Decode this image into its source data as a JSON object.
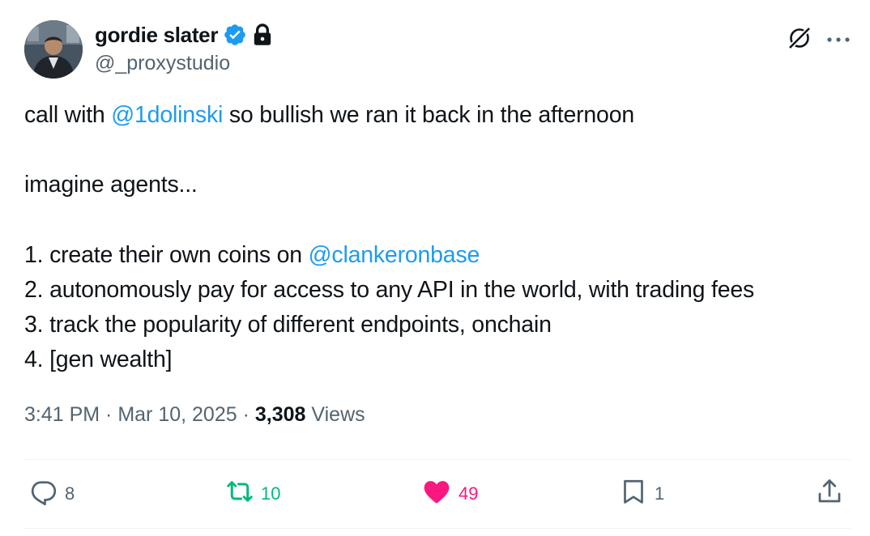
{
  "author": {
    "display_name": "gordie slater",
    "handle": "@_proxystudio",
    "verified_color": "#1d9bf0"
  },
  "tweet": {
    "lines": [
      [
        {
          "text": "call with "
        },
        {
          "text": "@1dolinski",
          "mention": true
        },
        {
          "text": " so bullish we ran it back in the afternoon"
        }
      ],
      [],
      [
        {
          "text": "imagine agents..."
        }
      ],
      [],
      [
        {
          "text": "1. create their own coins on "
        },
        {
          "text": "@clankeronbase",
          "mention": true
        }
      ],
      [
        {
          "text": "2. autonomously pay for access to any API in the world, with trading fees"
        }
      ],
      [
        {
          "text": "3. track the popularity of different endpoints, onchain"
        }
      ],
      [
        {
          "text": "4. [gen wealth]"
        }
      ]
    ]
  },
  "meta": {
    "time": "3:41 PM",
    "separator": " · ",
    "date": "Mar 10, 2025",
    "views_count": "3,308",
    "views_label": "Views"
  },
  "actions": {
    "replies": "8",
    "retweets": "10",
    "likes": "49",
    "bookmarks": "1"
  },
  "colors": {
    "mention": "#1d9bf0",
    "secondary_text": "#536471",
    "retweet": "#00ba7c",
    "like": "#f91880"
  }
}
